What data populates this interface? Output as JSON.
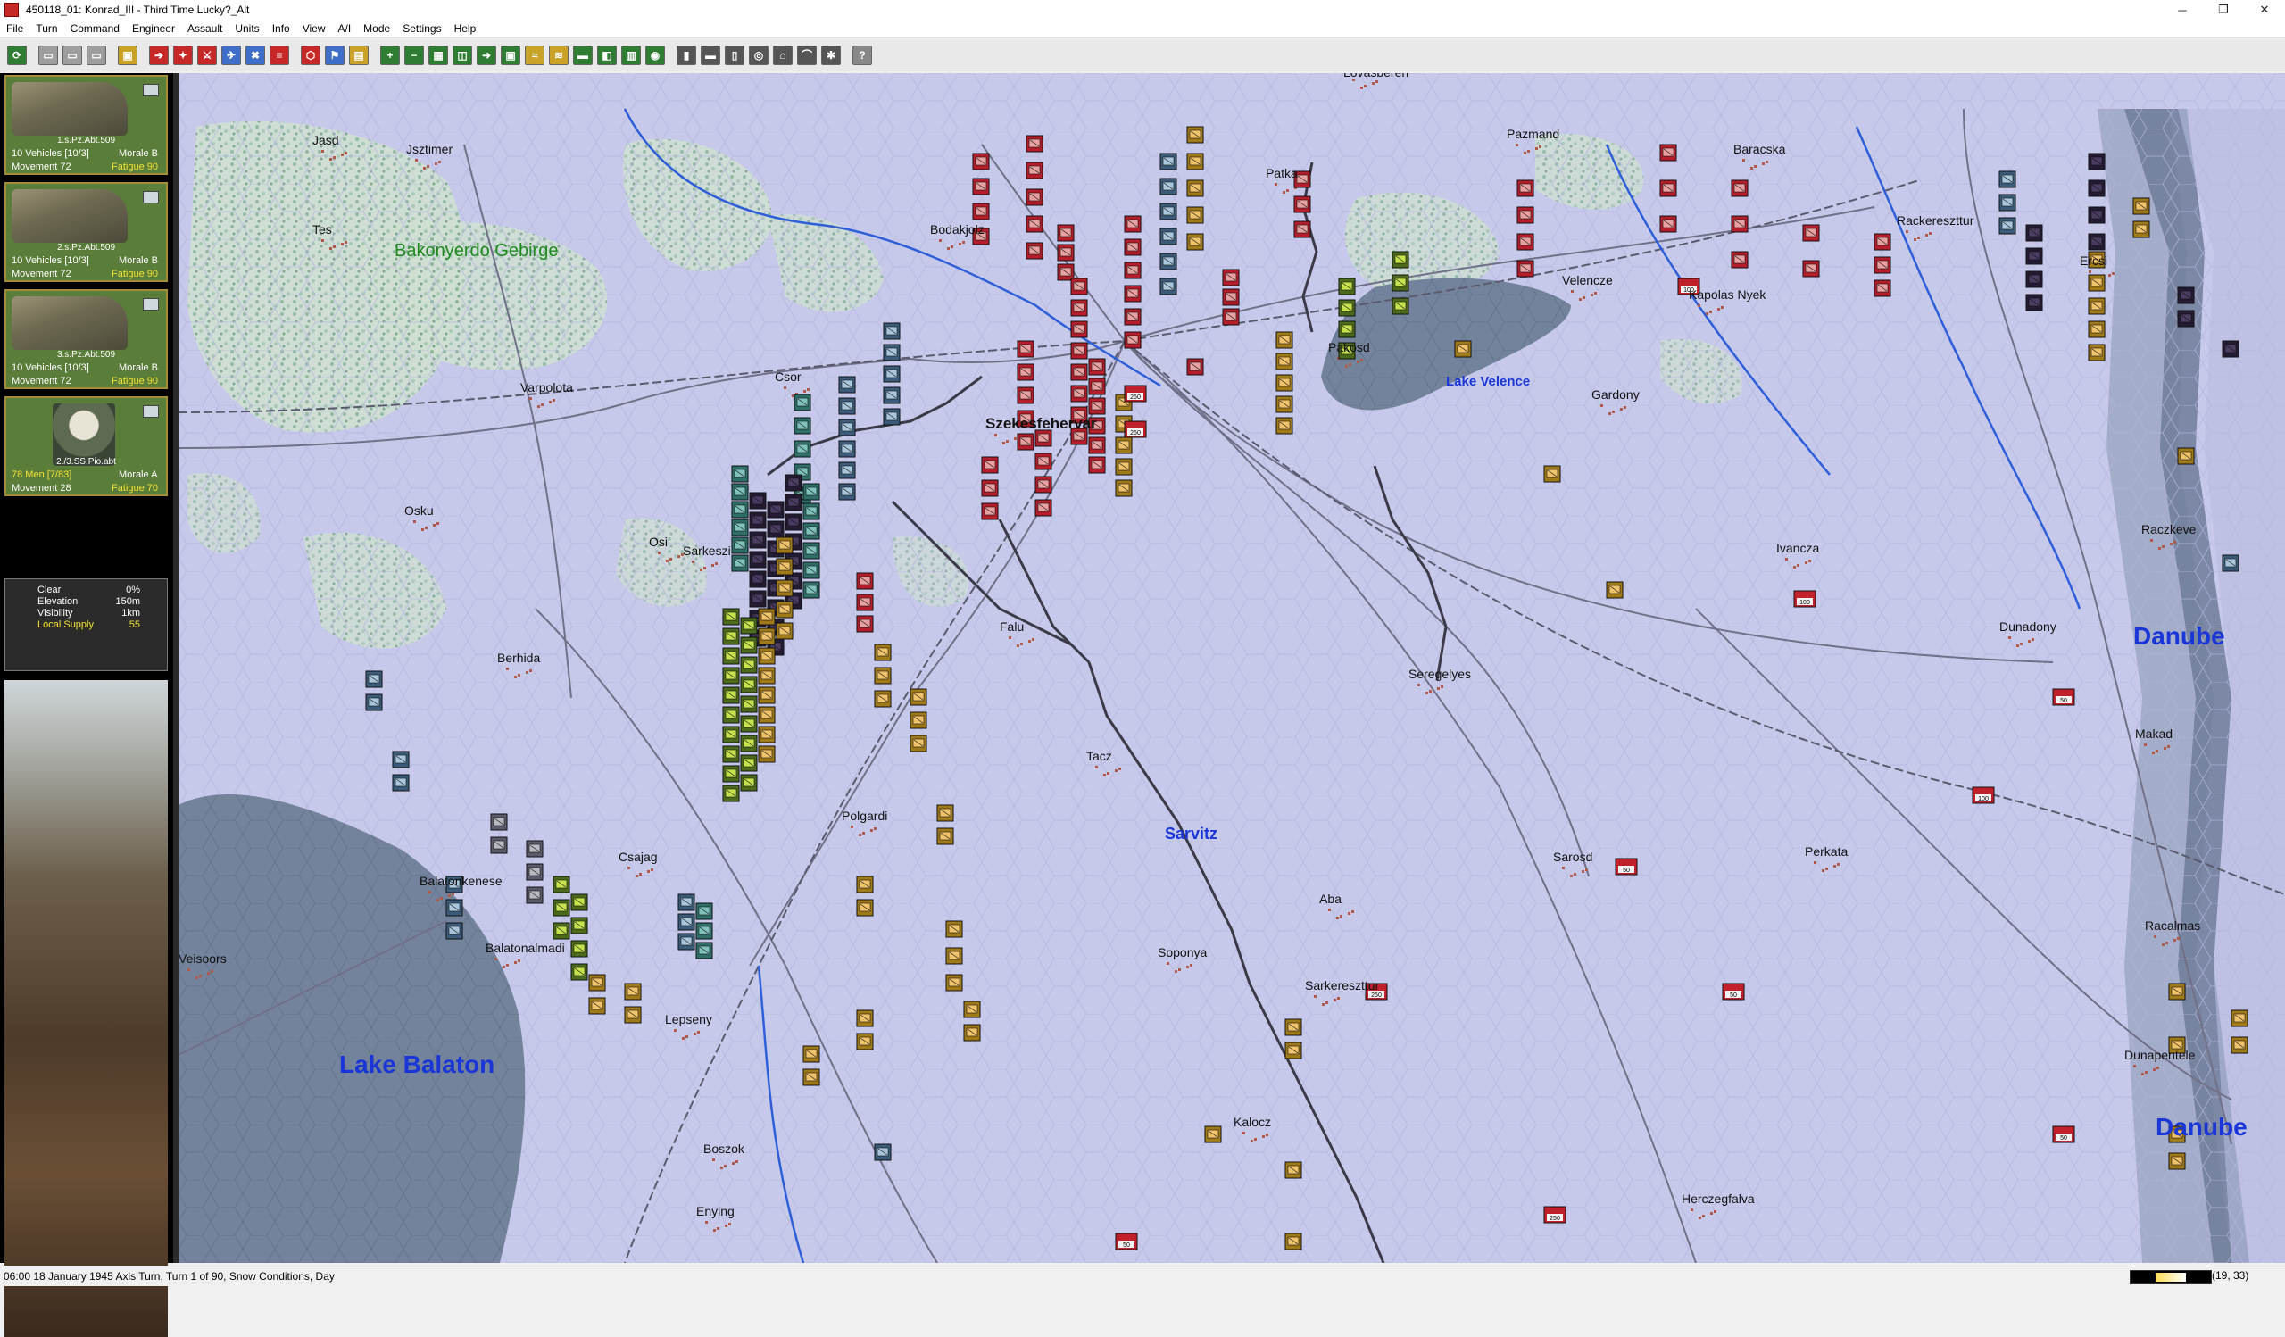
{
  "window": {
    "title": "450118_01: Konrad_III - Third Time Lucky?_Alt",
    "minimize": "─",
    "maximize": "❐",
    "close": "✕"
  },
  "menu": [
    "File",
    "Turn",
    "Command",
    "Engineer",
    "Assault",
    "Units",
    "Info",
    "View",
    "A/I",
    "Mode",
    "Settings",
    "Help"
  ],
  "toolbar": {
    "buttons": [
      {
        "icon": "refresh-icon",
        "color": "#2e7d32",
        "glyph": "⟳"
      },
      {
        "sep": true
      },
      {
        "icon": "save-icon",
        "color": "#9e9e9e",
        "glyph": "▭"
      },
      {
        "icon": "open-icon",
        "color": "#9e9e9e",
        "glyph": "▭"
      },
      {
        "icon": "print-icon",
        "color": "#9e9e9e",
        "glyph": "▭"
      },
      {
        "sep": true
      },
      {
        "icon": "unit-info-icon",
        "color": "#c9a227",
        "glyph": "▣"
      },
      {
        "sep": true
      },
      {
        "icon": "move-icon",
        "color": "#c62828",
        "glyph": "➔"
      },
      {
        "icon": "fire-icon",
        "color": "#c62828",
        "glyph": "✦"
      },
      {
        "icon": "attack-icon",
        "color": "#c62828",
        "glyph": "⚔"
      },
      {
        "icon": "air-icon",
        "color": "#3f6ec9",
        "glyph": "✈"
      },
      {
        "icon": "cross-icon",
        "color": "#3f6ec9",
        "glyph": "✖"
      },
      {
        "icon": "stack-icon",
        "color": "#c62828",
        "glyph": "≡"
      },
      {
        "sep": true
      },
      {
        "icon": "hex-icon",
        "color": "#c62828",
        "glyph": "⬡"
      },
      {
        "icon": "flag-icon",
        "color": "#3f6ec9",
        "glyph": "⚑"
      },
      {
        "icon": "report-icon",
        "color": "#c9a227",
        "glyph": "▤"
      },
      {
        "sep": true
      },
      {
        "icon": "zoom-in-icon",
        "color": "#2e7d32",
        "glyph": "+"
      },
      {
        "icon": "zoom-out-icon",
        "color": "#2e7d32",
        "glyph": "−"
      },
      {
        "icon": "grid-icon",
        "color": "#2e7d32",
        "glyph": "▦"
      },
      {
        "icon": "map-icon",
        "color": "#2e7d32",
        "glyph": "◫"
      },
      {
        "icon": "arrow-icon",
        "color": "#2e7d32",
        "glyph": "➜"
      },
      {
        "icon": "counter-icon",
        "color": "#2e7d32",
        "glyph": "▣"
      },
      {
        "icon": "terrain-icon",
        "color": "#c9a227",
        "glyph": "≈"
      },
      {
        "icon": "road-icon",
        "color": "#c9a227",
        "glyph": "≋"
      },
      {
        "icon": "vehicle-icon",
        "color": "#2e7d32",
        "glyph": "▬"
      },
      {
        "icon": "toggle-icon",
        "color": "#2e7d32",
        "glyph": "◧"
      },
      {
        "icon": "layer-icon",
        "color": "#2e7d32",
        "glyph": "▥"
      },
      {
        "icon": "radio-icon",
        "color": "#2e7d32",
        "glyph": "◉"
      },
      {
        "sep": true
      },
      {
        "icon": "lock-icon",
        "color": "#555",
        "glyph": "▮"
      },
      {
        "icon": "truck-icon",
        "color": "#555",
        "glyph": "▬"
      },
      {
        "icon": "supply-icon",
        "color": "#555",
        "glyph": "▯"
      },
      {
        "icon": "target-icon",
        "color": "#555",
        "glyph": "◎"
      },
      {
        "icon": "fort-icon",
        "color": "#555",
        "glyph": "⌂"
      },
      {
        "icon": "bridge-icon",
        "color": "#555",
        "glyph": "⌒"
      },
      {
        "icon": "mine-icon",
        "color": "#555",
        "glyph": "✱"
      },
      {
        "sep": true
      },
      {
        "icon": "help-icon",
        "color": "#888",
        "glyph": "?"
      }
    ]
  },
  "units": [
    {
      "name": "1.s.Pz.Abt.509",
      "strength": "10 Vehicles [10/3]",
      "morale": "Morale B",
      "movement": "Movement 72",
      "fatigue": "Fatigue 90",
      "type": "tank"
    },
    {
      "name": "2.s.Pz.Abt.509",
      "strength": "10 Vehicles [10/3]",
      "morale": "Morale B",
      "movement": "Movement 72",
      "fatigue": "Fatigue 90",
      "type": "tank"
    },
    {
      "name": "3.s.Pz.Abt.509",
      "strength": "10 Vehicles [10/3]",
      "morale": "Morale B",
      "movement": "Movement 72",
      "fatigue": "Fatigue 90",
      "type": "tank"
    },
    {
      "name": "2./3.SS.Pio.abt",
      "strength": "78 Men [7/83]",
      "morale": "Morale A",
      "movement": "Movement 28",
      "fatigue": "Fatigue 70",
      "type": "infantry"
    }
  ],
  "terrain": [
    {
      "label": "Clear",
      "value": "0%"
    },
    {
      "label": "Elevation",
      "value": "150m"
    },
    {
      "label": "Visibility",
      "value": "1km"
    },
    {
      "label": "Local Supply",
      "value": "55"
    }
  ],
  "map": {
    "colors": {
      "snow": "#c7c9ea",
      "lake": "#71809a",
      "river": "#2f5fd8",
      "forest": "#b9d6c4",
      "road": "#6d6d85"
    },
    "lakes": [
      "Lake Balaton",
      "Lake Velence"
    ],
    "rivers": [
      "Danube",
      "Danube",
      "Sarvitz"
    ],
    "hills": [
      "Bakonyerdo Gebirge"
    ],
    "towns": [
      "Jasd",
      "Jsztimer",
      "Tes",
      "Varpolota",
      "Osku",
      "Berhida",
      "Osi",
      "Sarkeszi",
      "Csor",
      "Szekesfehervar",
      "Bodakjolz",
      "Patka",
      "Pazmand",
      "Baracska",
      "Rackereszttur",
      "Ercsi",
      "Velencze",
      "Kapolas Nyek",
      "Pakosd",
      "Gardony",
      "Falu",
      "Seregelyes",
      "Ivancza",
      "Raczkeve",
      "Dunadony",
      "Makad",
      "Tacz",
      "Polgardi",
      "Csajag",
      "Balatonkenese",
      "Balatonalmadi",
      "Lepseny",
      "Soponya",
      "Aba",
      "Sarkereszttur",
      "Sarosd",
      "Perkata",
      "Racalmas",
      "Dunapentele",
      "Kalocz",
      "Boszok",
      "Enying",
      "Herczegfalva",
      "Veisoors",
      "Lovasberen"
    ],
    "supply_values": [
      "250",
      "250",
      "100",
      "100",
      "100",
      "50",
      "50",
      "250",
      "250",
      "50",
      "50",
      "50"
    ]
  },
  "status": {
    "text": "06:00 18 January 1945 Axis Turn, Turn 1 of 90, Snow Conditions, Day",
    "coords": "(19, 33)",
    "gauge_fraction": 0.55
  }
}
